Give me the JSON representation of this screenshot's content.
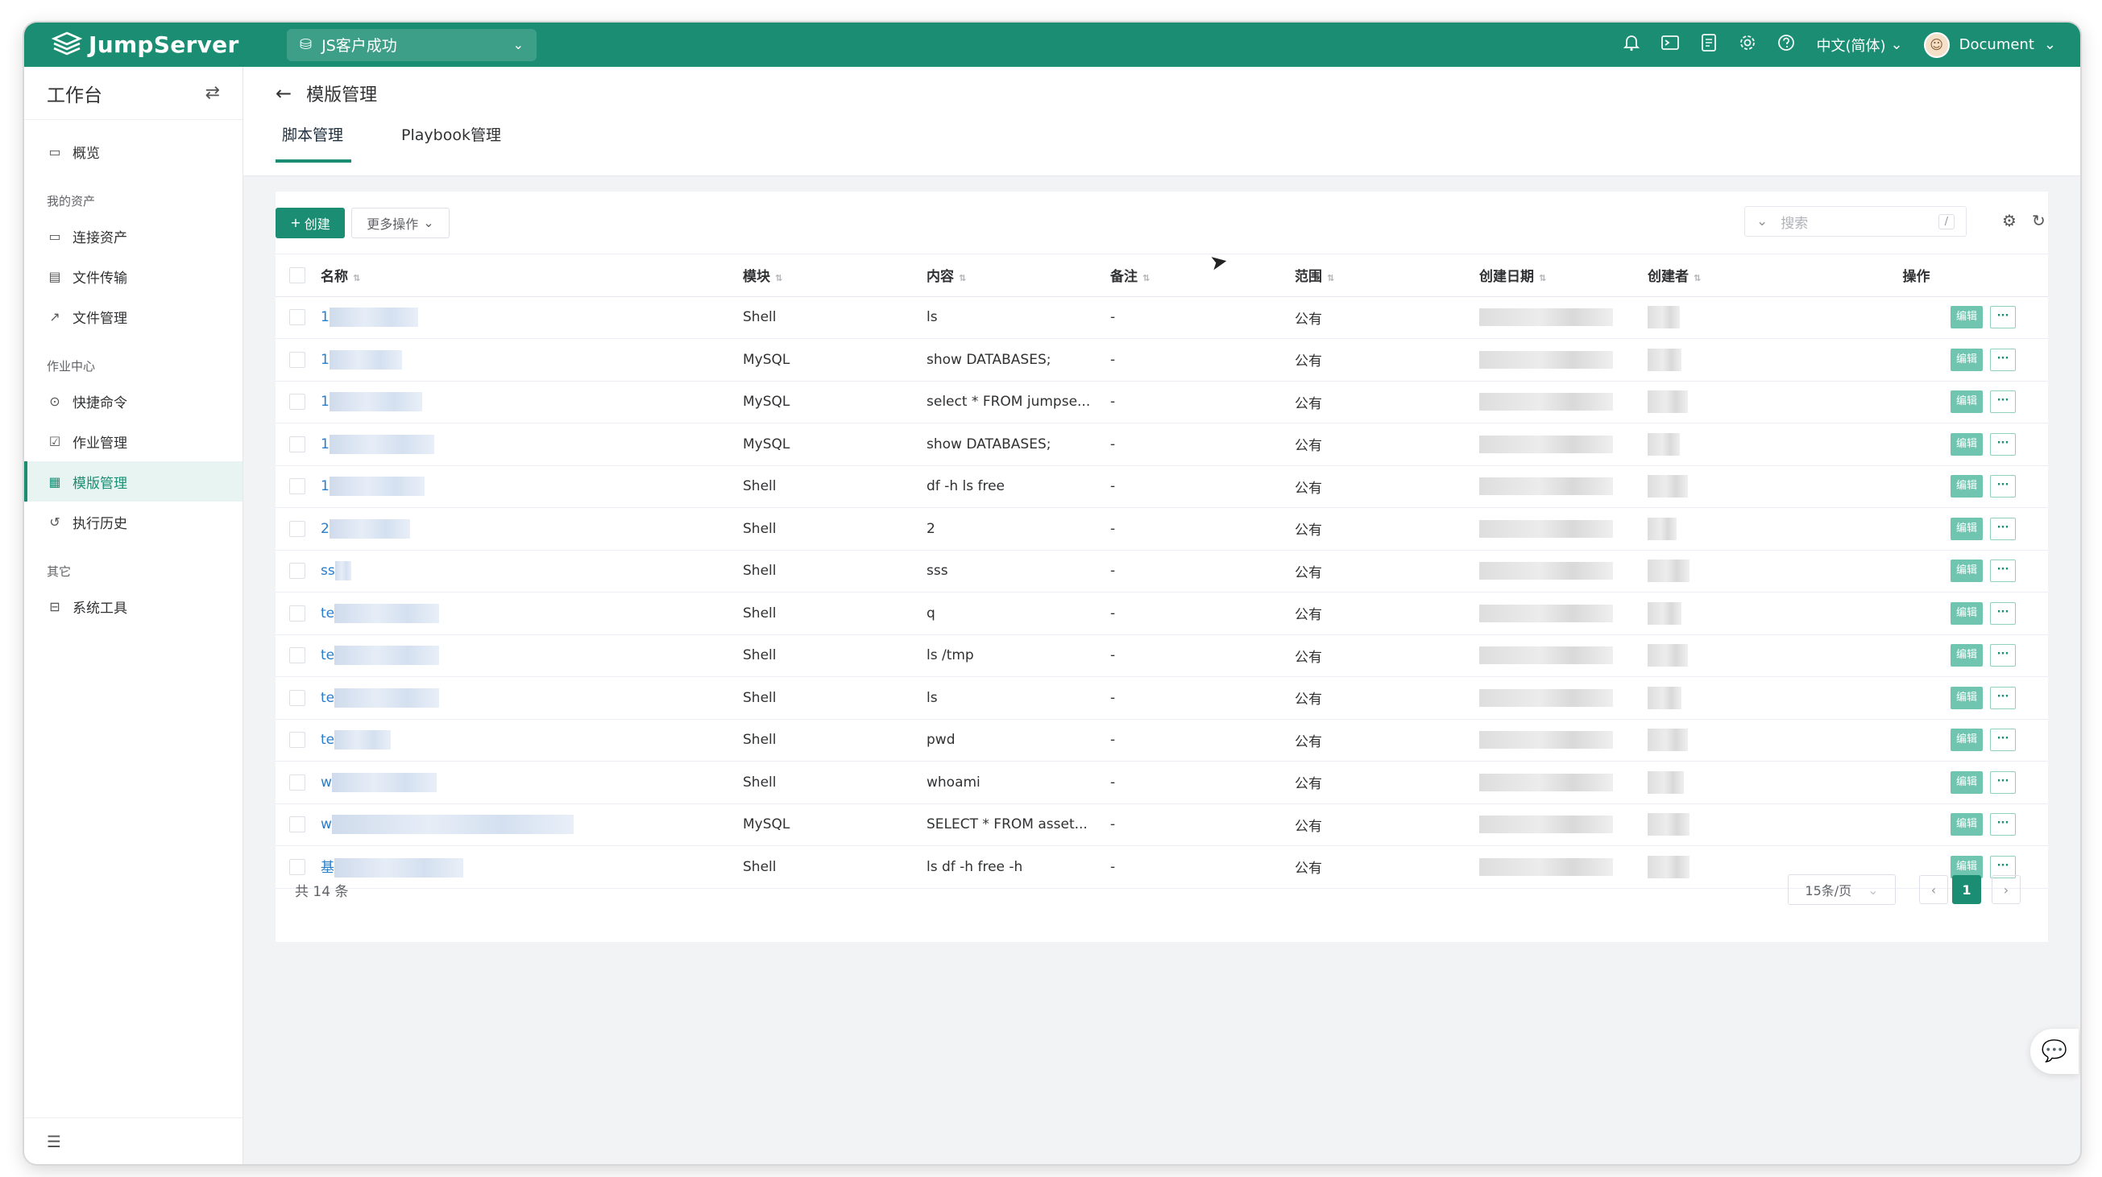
{
  "topbar": {
    "logo_text": "JumpServer",
    "org_name": "JS客户成功",
    "icons": [
      "bell-icon",
      "terminal-icon",
      "document-icon",
      "settings-icon",
      "help-icon"
    ],
    "language": "中文(简体)",
    "user_name": "Document"
  },
  "sidebar": {
    "title": "工作台",
    "groups": [
      {
        "label": "",
        "items": [
          {
            "label": "概览",
            "icon": "monitor-icon"
          }
        ]
      },
      {
        "label": "我的资产",
        "items": [
          {
            "label": "连接资产",
            "icon": "monitor-icon"
          },
          {
            "label": "文件传输",
            "icon": "file-icon"
          },
          {
            "label": "文件管理",
            "icon": "external-link-icon"
          }
        ]
      },
      {
        "label": "作业中心",
        "items": [
          {
            "label": "快捷命令",
            "icon": "play-icon"
          },
          {
            "label": "作业管理",
            "icon": "calendar-check-icon"
          },
          {
            "label": "模版管理",
            "icon": "template-icon",
            "active": true
          },
          {
            "label": "执行历史",
            "icon": "history-icon"
          }
        ]
      },
      {
        "label": "其它",
        "items": [
          {
            "label": "系统工具",
            "icon": "toolbox-icon"
          }
        ]
      }
    ]
  },
  "page": {
    "title": "模版管理",
    "tabs": [
      {
        "label": "脚本管理",
        "active": true
      },
      {
        "label": "Playbook管理",
        "active": false
      }
    ]
  },
  "toolbar": {
    "create_label": "创建",
    "more_label": "更多操作",
    "search_placeholder": "搜索",
    "search_shortcut": "/"
  },
  "table": {
    "headers": {
      "name": "名称",
      "module": "模块",
      "content": "内容",
      "comment": "备注",
      "scope": "范围",
      "created": "创建日期",
      "creator": "创建者",
      "actions": "操作"
    },
    "rows": [
      {
        "name": "1",
        "module": "Shell",
        "content": "ls",
        "comment": "-",
        "scope": "公有"
      },
      {
        "name": "1",
        "module": "MySQL",
        "content": "show DATABASES;",
        "comment": "-",
        "scope": "公有"
      },
      {
        "name": "1",
        "module": "MySQL",
        "content": "select * FROM jumpse...",
        "comment": "-",
        "scope": "公有"
      },
      {
        "name": "1",
        "module": "MySQL",
        "content": "show DATABASES;",
        "comment": "-",
        "scope": "公有"
      },
      {
        "name": "1",
        "module": "Shell",
        "content": "df -h ls free",
        "comment": "-",
        "scope": "公有"
      },
      {
        "name": "2",
        "module": "Shell",
        "content": "2",
        "comment": "-",
        "scope": "公有"
      },
      {
        "name": "ss",
        "module": "Shell",
        "content": "sss",
        "comment": "-",
        "scope": "公有"
      },
      {
        "name": "te",
        "module": "Shell",
        "content": "q",
        "comment": "-",
        "scope": "公有"
      },
      {
        "name": "te",
        "module": "Shell",
        "content": "ls /tmp",
        "comment": "-",
        "scope": "公有"
      },
      {
        "name": "te",
        "module": "Shell",
        "content": "ls",
        "comment": "-",
        "scope": "公有"
      },
      {
        "name": "te",
        "module": "Shell",
        "content": "pwd",
        "comment": "-",
        "scope": "公有"
      },
      {
        "name": "w",
        "module": "Shell",
        "content": "whoami",
        "comment": "-",
        "scope": "公有"
      },
      {
        "name": "w",
        "module": "MySQL",
        "content": "SELECT * FROM asset...",
        "comment": "-",
        "scope": "公有"
      },
      {
        "name": "基",
        "module": "Shell",
        "content": "ls df -h free -h",
        "comment": "-",
        "scope": "公有"
      }
    ],
    "edit_label": "编辑",
    "more_label": "···"
  },
  "pagination": {
    "total_text": "共 14 条",
    "page_size": "15条/页",
    "current_page": "1"
  },
  "colors": {
    "brand": "#1a8d73",
    "link": "#2a7dc9"
  }
}
